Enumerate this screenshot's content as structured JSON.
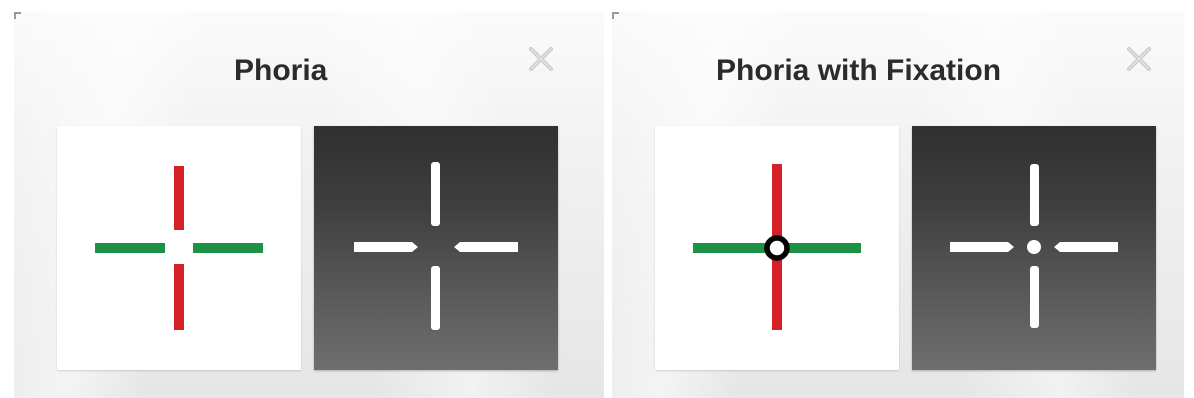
{
  "panels": [
    {
      "title": "Phoria",
      "close_icon": "close-icon",
      "light_target": {
        "icon": "split-cross-target-icon",
        "vertical_color": "#d42027",
        "horizontal_color": "#1d9245",
        "fixation": false
      },
      "dark_target": {
        "icon": "split-cross-target-icon",
        "line_color": "#ffffff",
        "fixation": false
      }
    },
    {
      "title": "Phoria with Fixation",
      "close_icon": "close-icon",
      "light_target": {
        "icon": "cross-with-fixation-ring-icon",
        "vertical_color": "#d42027",
        "horizontal_color": "#1d9245",
        "ring_color": "#000000",
        "fixation": true
      },
      "dark_target": {
        "icon": "split-cross-with-fixation-dot-icon",
        "line_color": "#ffffff",
        "dot_color": "#ffffff",
        "fixation": true
      }
    }
  ]
}
